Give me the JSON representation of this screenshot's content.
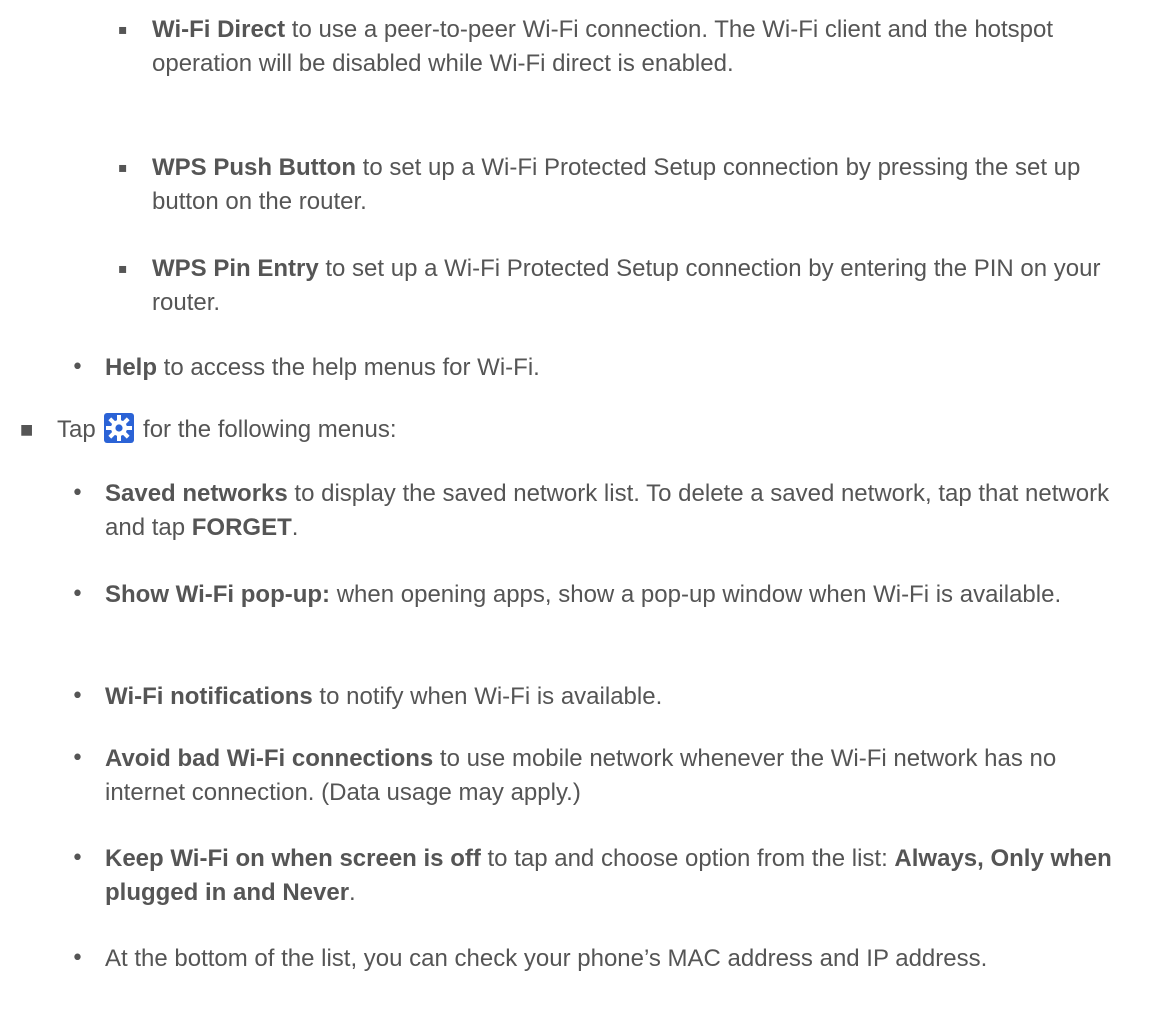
{
  "menu_a": [
    {
      "term": "Wi-Fi Direct",
      "desc": " to use a peer-to-peer Wi-Fi connection. The Wi-Fi client and the hotspot operation will be disabled while Wi-Fi direct is enabled."
    },
    {
      "term": "WPS Push Button",
      "desc": " to set up a Wi-Fi Protected Setup connection by pressing the set up button on the router."
    },
    {
      "term": "WPS Pin Entry",
      "desc": " to set up a Wi-Fi Protected Setup connection by entering the PIN on your router."
    }
  ],
  "help": {
    "term": "Help",
    "desc": " to access the help menus for Wi-Fi."
  },
  "tap_line": {
    "before": "Tap ",
    "icon": "settings-gear-icon",
    "after": " for the following menus:"
  },
  "menu_b": [
    {
      "term": "Saved networks",
      "desc": " to display the saved network list. To delete a saved network, tap that network and tap ",
      "term2": "FORGET",
      "desc2": "."
    },
    {
      "term": "Show Wi-Fi pop-up:",
      "desc": " when opening apps, show a pop-up window when Wi-Fi is available."
    },
    {
      "term": "Wi-Fi notifications",
      "desc": " to notify when Wi-Fi is available."
    },
    {
      "term": "Avoid bad Wi-Fi connections",
      "desc": " to use mobile network whenever the Wi-Fi network has no internet connection. (Data usage may apply.)"
    },
    {
      "term": "Keep Wi-Fi on when screen is off",
      "desc": " to tap and choose option from the list: ",
      "term2": "Always, Only when plugged in and Never",
      "desc2": "."
    },
    {
      "desc": "At the bottom of the list, you can check your phone’s MAC address and IP address."
    }
  ],
  "colors": {
    "text": "#555555",
    "icon_bg": "#2b63d6"
  }
}
